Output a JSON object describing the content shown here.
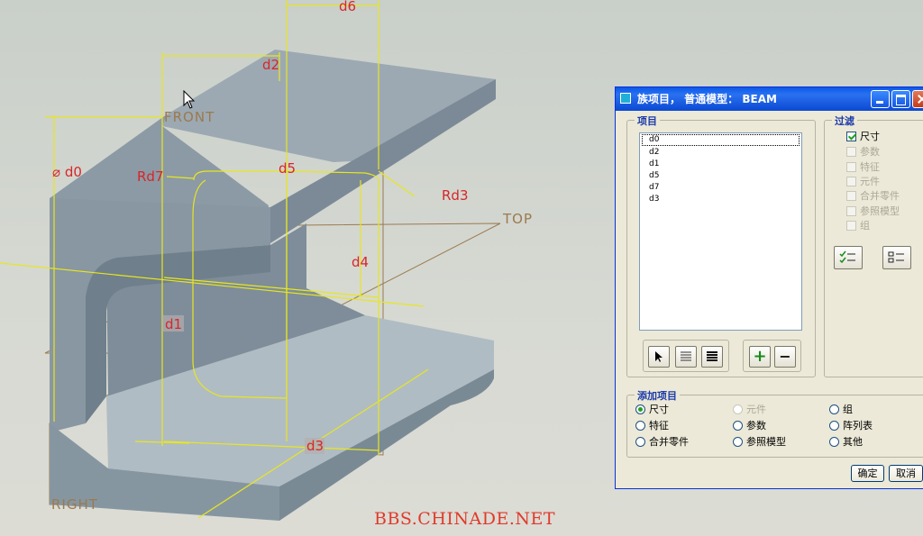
{
  "viewport": {
    "dimensions": [
      "d6",
      "d2",
      "d0",
      "Rd7",
      "d5",
      "Rd3",
      "d4",
      "d1",
      "d3"
    ],
    "planes": [
      "FRONT",
      "TOP",
      "RIGHT"
    ],
    "watermark": "BBS.CHINADE.NET",
    "colors": {
      "part": "#8f9ea8",
      "dim_line": "#e8e61e",
      "dim_text": "#d8262a",
      "plane": "#9b7a4e"
    }
  },
  "dialog": {
    "title": "族项目， 普通模型： BEAM",
    "items_group": {
      "label": "项目",
      "items": [
        "d0",
        "d2",
        "d1",
        "d5",
        "d7",
        "d3"
      ],
      "selected": "d0",
      "buttons": [
        {
          "icon": "arrow-pointer-icon"
        },
        {
          "icon": "list-lines-icon"
        },
        {
          "icon": "list-bars-icon"
        },
        {
          "icon": "plus-icon",
          "text": "+"
        },
        {
          "icon": "minus-icon",
          "text": "−"
        }
      ]
    },
    "filter_group": {
      "label": "过滤",
      "options": [
        {
          "label": "尺寸",
          "checked": true,
          "enabled": true
        },
        {
          "label": "参数",
          "checked": false,
          "enabled": false
        },
        {
          "label": "特征",
          "checked": false,
          "enabled": false
        },
        {
          "label": "元件",
          "checked": false,
          "enabled": false
        },
        {
          "label": "合并零件",
          "checked": false,
          "enabled": false
        },
        {
          "label": "参照模型",
          "checked": false,
          "enabled": false
        },
        {
          "label": "组",
          "checked": false,
          "enabled": false
        }
      ],
      "buttons": [
        {
          "icon": "select-all-icon"
        },
        {
          "icon": "clear-all-icon"
        }
      ]
    },
    "add_group": {
      "label": "添加项目",
      "options": [
        {
          "label": "尺寸",
          "selected": true,
          "enabled": true
        },
        {
          "label": "元件",
          "selected": false,
          "enabled": false
        },
        {
          "label": "组",
          "selected": false,
          "enabled": true
        },
        {
          "label": "特征",
          "selected": false,
          "enabled": true
        },
        {
          "label": "参数",
          "selected": false,
          "enabled": true
        },
        {
          "label": "阵列表",
          "selected": false,
          "enabled": true
        },
        {
          "label": "合并零件",
          "selected": false,
          "enabled": true
        },
        {
          "label": "参照模型",
          "selected": false,
          "enabled": true
        },
        {
          "label": "其他",
          "selected": false,
          "enabled": true
        }
      ]
    },
    "ok_label": "确定",
    "cancel_label": "取消"
  }
}
